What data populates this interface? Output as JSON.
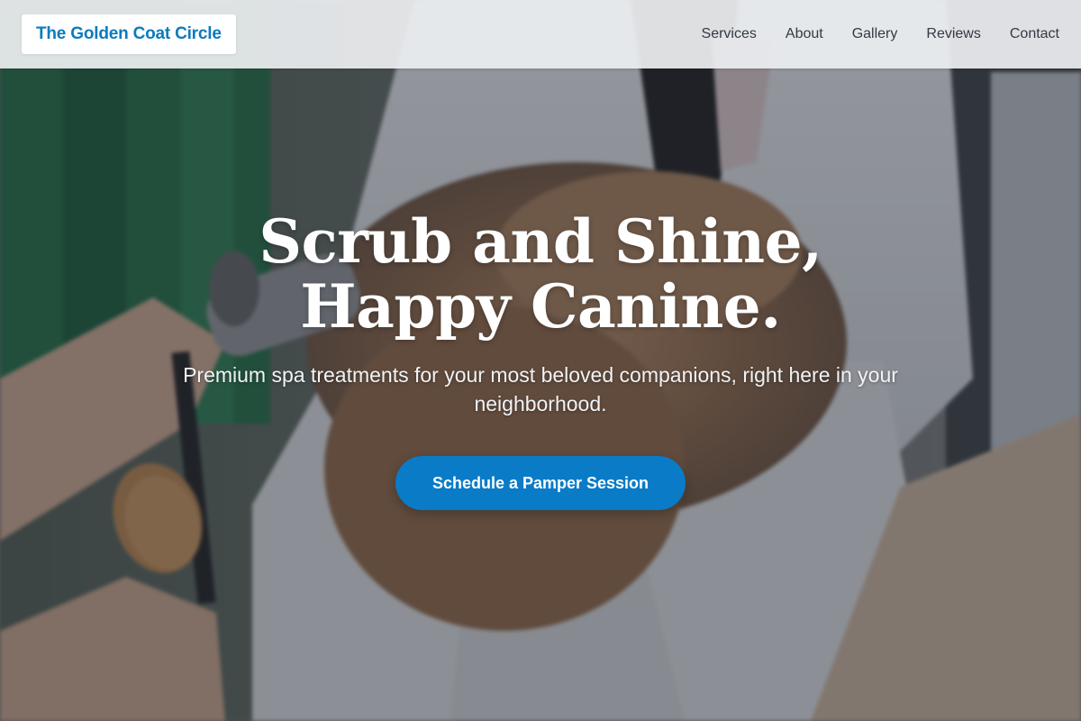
{
  "header": {
    "logo_text": "The Golden Coat Circle",
    "nav": [
      {
        "label": "Services"
      },
      {
        "label": "About"
      },
      {
        "label": "Gallery"
      },
      {
        "label": "Reviews"
      },
      {
        "label": "Contact"
      }
    ]
  },
  "hero": {
    "title": "Scrub and Shine, Happy Canine.",
    "subtitle": "Premium spa treatments for your most beloved companions, right here in your neighborhood.",
    "cta_label": "Schedule a Pamper Session",
    "background_image": "dog-grooming-photo"
  },
  "colors": {
    "brand": "#0a7bbd",
    "cta": "#0a7bc7",
    "nav_text": "#333a44",
    "header_bg": "#eceef0"
  }
}
